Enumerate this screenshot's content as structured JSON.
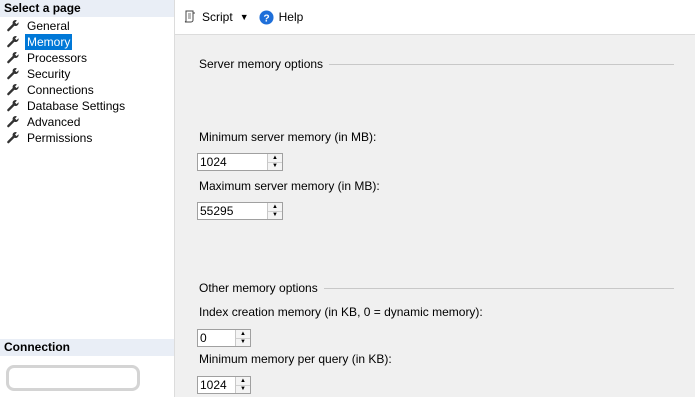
{
  "left_panel": {
    "select_page_header": "Select a page",
    "pages": [
      {
        "label": "General",
        "selected": false
      },
      {
        "label": "Memory",
        "selected": true
      },
      {
        "label": "Processors",
        "selected": false
      },
      {
        "label": "Security",
        "selected": false
      },
      {
        "label": "Connections",
        "selected": false
      },
      {
        "label": "Database Settings",
        "selected": false
      },
      {
        "label": "Advanced",
        "selected": false
      },
      {
        "label": "Permissions",
        "selected": false
      }
    ],
    "connection_header": "Connection"
  },
  "toolbar": {
    "script_label": "Script",
    "help_label": "Help"
  },
  "server_memory": {
    "group_title": "Server memory options",
    "min_label": "Minimum server memory (in MB):",
    "min_value": "1024",
    "max_label": "Maximum server memory (in MB):",
    "max_value": "55295"
  },
  "other_memory": {
    "group_title": "Other memory options",
    "index_label": "Index creation memory (in KB, 0 = dynamic memory):",
    "index_value": "0",
    "min_query_label": "Minimum memory per query (in KB):",
    "min_query_value": "1024"
  },
  "colors": {
    "selection": "#0078d7",
    "header_bg": "#e9eef6",
    "help_icon": "#1e6fd9"
  }
}
